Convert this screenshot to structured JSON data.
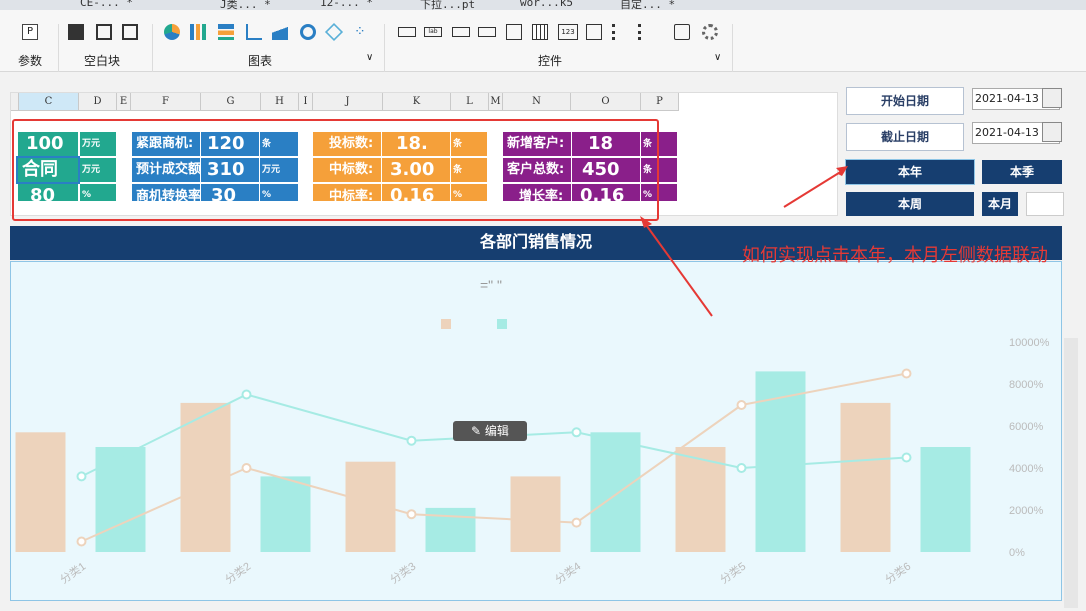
{
  "tabs": [
    "CE-... *",
    "J类... *",
    "12-... *",
    "下拉...pt",
    "wor...k5",
    "自定... *"
  ],
  "ribbon": {
    "groups": [
      "参数",
      "空白块",
      "图表",
      "控件"
    ]
  },
  "sheet": {
    "columns": [
      "C",
      "D",
      "E",
      "F",
      "G",
      "H",
      "I",
      "J",
      "K",
      "L",
      "M",
      "N",
      "O",
      "P"
    ],
    "teal": [
      {
        "label": "合同",
        "value": "100",
        "unit": "万元"
      },
      {
        "label": "",
        "value": "",
        "unit": "万元"
      },
      {
        "label": "",
        "value": "80",
        "unit": "%"
      }
    ],
    "blue": [
      {
        "label": "紧跟商机:",
        "value": "120",
        "unit": "条"
      },
      {
        "label": "预计成交额",
        "value": "310",
        "unit": "万元"
      },
      {
        "label": "商机转换率",
        "value": "30",
        "unit": "%"
      }
    ],
    "orange": [
      {
        "label": "投标数:",
        "value": "18.",
        "unit": "条"
      },
      {
        "label": "中标数:",
        "value": "3.00",
        "unit": "条"
      },
      {
        "label": "中标率:",
        "value": "0.16",
        "unit": "%"
      }
    ],
    "purple": [
      {
        "label": "新增客户:",
        "value": "18",
        "unit": "条"
      },
      {
        "label": "客户总数:",
        "value": "450",
        "unit": "条"
      },
      {
        "label": "增长率:",
        "value": "0.16",
        "unit": "%"
      }
    ]
  },
  "filters": {
    "start_label": "开始日期",
    "start_value": "2021-04-13",
    "end_label": "截止日期",
    "end_value": "2021-04-13",
    "btn_year": "本年",
    "btn_season": "本季",
    "btn_week": "本周",
    "btn_month": "本月"
  },
  "banner": "各部门销售情况",
  "annotation": "如何实现点击本年，本月左侧数据联动",
  "edit_label": "编辑",
  "chart_title": "=\" \"",
  "colors": {
    "bar1": "#edd3bc",
    "bar2": "#a6ebe4",
    "line1": "#edd3bc",
    "line2": "#a6ebe4",
    "navy": "#163e70",
    "red": "#e53935"
  },
  "chart_data": {
    "type": "bar",
    "categories": [
      "分类1",
      "分类2",
      "分类3",
      "分类4",
      "分类5",
      "分类6"
    ],
    "series": [
      {
        "type": "bar",
        "values": [
          5700,
          7100,
          4300,
          3600,
          5000,
          7100
        ]
      },
      {
        "type": "bar",
        "values": [
          5000,
          3600,
          2100,
          5700,
          8600,
          5000
        ]
      },
      {
        "type": "line",
        "values": [
          500,
          4000,
          1800,
          1400,
          7000,
          8500
        ]
      },
      {
        "type": "line",
        "values": [
          3600,
          7500,
          5300,
          5700,
          4000,
          4500
        ]
      }
    ],
    "y_right_ticks": [
      "0%",
      "2000%",
      "4000%",
      "6000%",
      "8000%",
      "10000%"
    ],
    "ylim": [
      0,
      10000
    ]
  }
}
